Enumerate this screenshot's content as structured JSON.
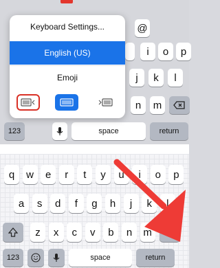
{
  "popup": {
    "items": [
      {
        "label": "Keyboard Settings..."
      },
      {
        "label": "English (US)",
        "active": true
      },
      {
        "label": "Emoji"
      }
    ],
    "layout_icons": [
      "keyboard-left-icon",
      "keyboard-full-icon",
      "keyboard-right-icon"
    ]
  },
  "top_keyboard": {
    "row1": [
      "@",
      "i",
      "o",
      "p"
    ],
    "row2": [
      "j",
      "k",
      "l"
    ],
    "row3": [
      "n",
      "m"
    ],
    "bottom": {
      "numbers": "123",
      "space": "space",
      "return": "return"
    }
  },
  "keyboard": {
    "row1": [
      "q",
      "w",
      "e",
      "r",
      "t",
      "y",
      "u",
      "i",
      "o",
      "p"
    ],
    "row2": [
      "a",
      "s",
      "d",
      "f",
      "g",
      "h",
      "j",
      "k",
      "l"
    ],
    "row3": [
      "z",
      "x",
      "c",
      "v",
      "b",
      "n",
      "m"
    ],
    "bottom": {
      "numbers": "123",
      "space": "space",
      "return": "return"
    }
  },
  "colors": {
    "accent": "#1a73e8",
    "highlight": "#d93025",
    "arrow": "#ee3b36"
  }
}
